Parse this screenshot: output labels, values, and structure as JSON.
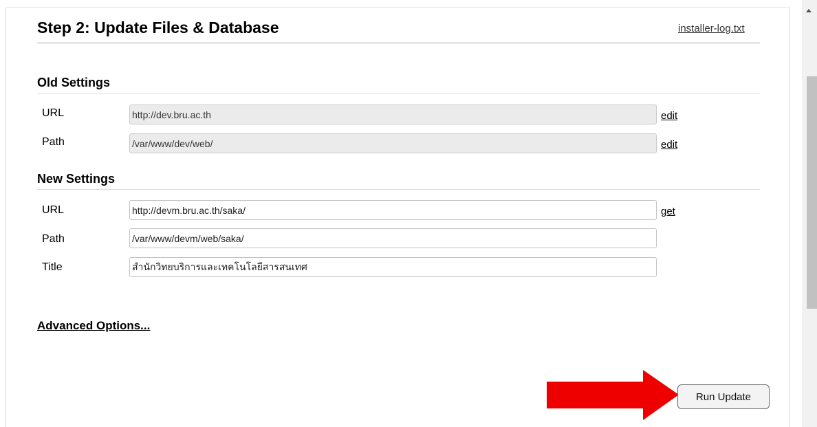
{
  "header": {
    "step_title": "Step 2: Update Files & Database",
    "log_link": "installer-log.txt"
  },
  "old_settings": {
    "heading": "Old Settings",
    "rows": [
      {
        "label": "URL",
        "value": "http://dev.bru.ac.th",
        "action": "edit"
      },
      {
        "label": "Path",
        "value": "/var/www/dev/web/",
        "action": "edit"
      }
    ]
  },
  "new_settings": {
    "heading": "New Settings",
    "rows": [
      {
        "label": "URL",
        "value": "http://devm.bru.ac.th/saka/",
        "action": "get"
      },
      {
        "label": "Path",
        "value": "/var/www/devm/web/saka/"
      },
      {
        "label": "Title",
        "value": "สำนักวิทยบริการและเทคโนโลยีสารสนเทศ"
      }
    ]
  },
  "advanced_options": "Advanced Options...",
  "run_button": "Run Update",
  "colors": {
    "arrow": "#ee0000",
    "readonly_field": "#ebebeb",
    "scroll_thumb": "#c1c1c1"
  },
  "icons": {
    "scroll_up": "triangle-up",
    "pointer_arrow": "arrow-right"
  }
}
